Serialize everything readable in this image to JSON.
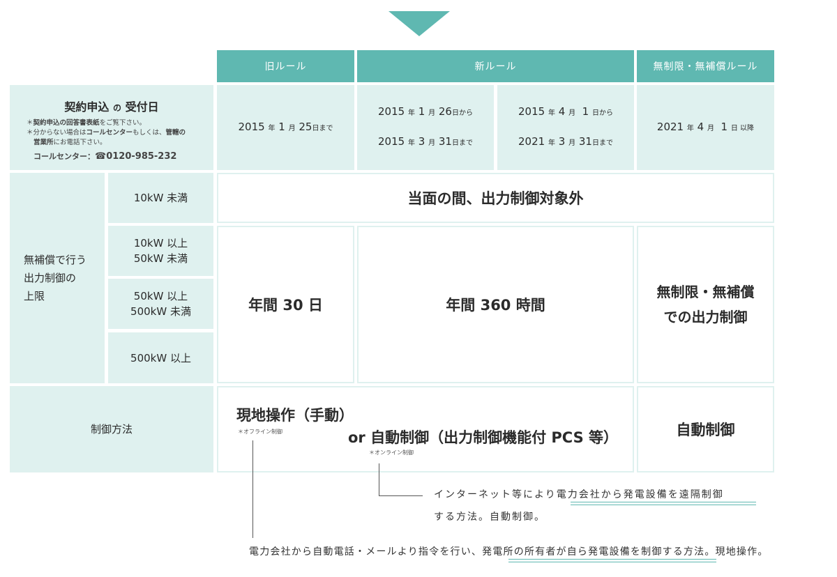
{
  "headers": {
    "old_rule": "旧ルール",
    "new_rule": "新ルール",
    "unlimited_rule": "無制限・無補償ルール"
  },
  "reception": {
    "title_a": "契約申込",
    "title_b": "の",
    "title_c": "受付日",
    "note1_prefix": "＊",
    "note1_bold": "契約申込の回答書表紙",
    "note1_rest": "をご覧下さい。",
    "note2_prefix": "＊分からない場合は",
    "note2_bold1": "コールセンター",
    "note2_mid": "もしくは、",
    "note2_bold2": "管轄の",
    "note2_line2_bold": "営業所",
    "note2_line2_rest": "にお電話下さい。",
    "call_label": "コールセンター：",
    "call_number": "☎0120-985-232"
  },
  "dates": {
    "old": {
      "y": "2015",
      "y_u": "年",
      "m": "1",
      "m_u": "月",
      "d": "25",
      "suffix": "日まで"
    },
    "new1_from": {
      "y": "2015",
      "y_u": "年",
      "m": "1",
      "m_u": "月",
      "d": "26",
      "suffix": "日から"
    },
    "new1_to": {
      "y": "2015",
      "y_u": "年",
      "m": "3",
      "m_u": "月",
      "d": "31",
      "suffix": "日まで"
    },
    "new2_from": {
      "y": "2015",
      "y_u": "年",
      "m": "4",
      "m_u": "月",
      "d": "1",
      "suffix": "日から"
    },
    "new2_to": {
      "y": "2021",
      "y_u": "年",
      "m": "3",
      "m_u": "月",
      "d": "31",
      "suffix": "日まで"
    },
    "unlimited": {
      "y": "2021",
      "y_u": "年",
      "m": "4",
      "m_u": "月",
      "d": "1",
      "suffix": "日 以降"
    }
  },
  "limit": {
    "label_line1": "無補償で行う",
    "label_line2": "出力制御の",
    "label_line3": "上限",
    "cap1": "10kW 未満",
    "cap2_line1": "10kW 以上",
    "cap2_line2": "50kW 未満",
    "cap3_line1": "50kW 以上",
    "cap3_line2": "500kW 未満",
    "cap4": "500kW 以上",
    "exempt": "当面の間、出力制御対象外",
    "old_value": "年間 30 日",
    "new_value": "年間 360 時間",
    "unlimited_line1": "無制限・無補償",
    "unlimited_line2": "での出力制御"
  },
  "method": {
    "label": "制御方法",
    "manual": "現地操作（手動）",
    "manual_note": "＊オフライン制御",
    "auto": "or 自動制御（出力制御機能付 PCS 等）",
    "auto_note": "＊オンライン制御",
    "unlimited": "自動制御"
  },
  "annotations": {
    "online_line1_a": "インターネット等により",
    "online_line1_b": "電力会社から発電設備を遠隔制御",
    "online_line2": "する方法。自動制御。",
    "offline_a": "電力会社から自動電話・メールより指令を行い、",
    "offline_b": "発電所の所有者が自ら発電設備を制御する方法",
    "offline_c": "。現地操作。"
  },
  "colors": {
    "accent": "#5fb8b1",
    "light": "#dff1ef"
  }
}
